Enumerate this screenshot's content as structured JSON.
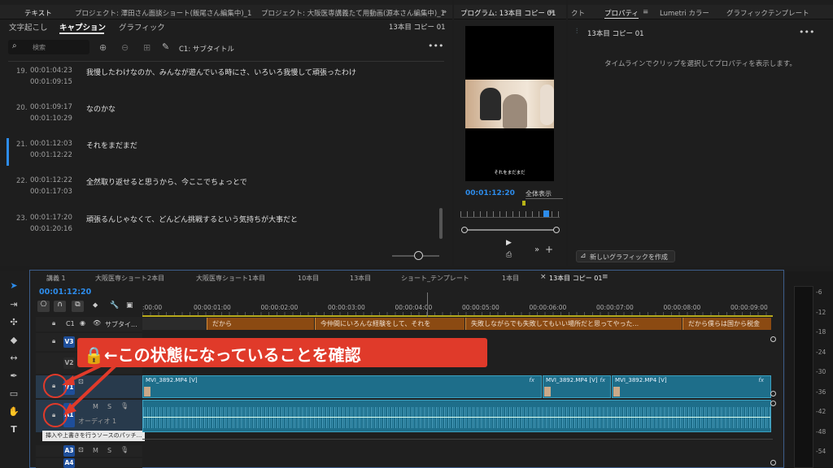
{
  "colors": {
    "accent": "#2d8ceb",
    "caption_clip": "#8b4a12",
    "video_clip": "#1e6e8a",
    "callout": "#e03a2a",
    "track_blue": "#1e4e9a"
  },
  "text_panel": {
    "tabs": [
      "テキスト",
      "プロジェクト: 澤田さん面談ショート(飯尾さん編集中)_1",
      "プロジェクト: 大阪医専講義たて用動画(源本さん編集中)_1"
    ],
    "subtabs": [
      "文字起こし",
      "キャプション",
      "グラフィック"
    ],
    "sequence_name": "13本目 コピー 01",
    "search_placeholder": "検索",
    "track_label": "C1: サブタイトル",
    "captions": [
      {
        "num": "19.",
        "in": "00:01:04:23",
        "out": "00:01:09:15",
        "text": "我慢したわけなのか、みんなが遊んでいる時にさ、いろいろ我慢して頑張ったわけ"
      },
      {
        "num": "20.",
        "in": "00:01:09:17",
        "out": "00:01:10:29",
        "text": "なのかな"
      },
      {
        "num": "21.",
        "in": "00:01:12:03",
        "out": "00:01:12:22",
        "text": "それをまだまだ"
      },
      {
        "num": "22.",
        "in": "00:01:12:22",
        "out": "00:01:17:03",
        "text": "全然取り返せると思うから、今ここでちょっとで"
      },
      {
        "num": "23.",
        "in": "00:01:17:20",
        "out": "00:01:20:16",
        "text": "頑張るんじゃなくて、どんどん挑戦するという気持ちが大事だと"
      }
    ]
  },
  "program_monitor": {
    "tab": "プログラム: 13本目 コピー 01",
    "timecode": "00:01:12:20",
    "zoom": "全体表示",
    "subtitle": "それをまだまだ"
  },
  "properties": {
    "tabs": [
      "クト",
      "プロパティ",
      "Lumetri カラー",
      "グラフィックテンプレート"
    ],
    "title": "13本目 コピー 01",
    "message": "タイムラインでクリップを選択してプロパティを表示します。",
    "new_graphic": "新しいグラフィックを作成"
  },
  "timeline": {
    "tabs": [
      "講義 1",
      "大阪医専ショート2本目",
      "大阪医専ショート1本目",
      "10本目",
      "13本目",
      "ショート_テンプレート",
      "1本目",
      "13本目 コピー 01"
    ],
    "timecode": "00:01:12:20",
    "ruler": [
      ":00:00",
      "00:00:01:00",
      "00:00:02:00",
      "00:00:03:00",
      "00:00:04:00",
      "00:00:05:00",
      "00:00:06:00",
      "00:00:07:00",
      "00:00:08:00",
      "00:00:09:00"
    ],
    "caption_track_label": "C1",
    "caption_track_name": "サブタイ...",
    "caption_clips": [
      "だから",
      "今仲間にいろんな経験をして、それを",
      "失敗しながらでも失敗してもいい場所だと思ってやった...",
      "だから僕らは国から税金"
    ],
    "video_clips": [
      "MVI_3892.MP4 [V]",
      "MVI_3892.MP4 [V]",
      "MVI_3892.MP4 [V]"
    ],
    "tracks": {
      "v3": "V3",
      "v2": "V2",
      "v1": "V1",
      "a1": "A1",
      "a3": "A3",
      "a4": "A4",
      "m": "M",
      "s": "S"
    },
    "audio_name": "オーディオ 1",
    "tooltip": "挿入や上書きを行うソースのパッチ..."
  },
  "callout": {
    "text": "🔒←この状態になっていることを確認"
  },
  "meter_labels": [
    "-6",
    "-12",
    "-18",
    "-24",
    "-30",
    "-36",
    "-42",
    "-48",
    "-54"
  ]
}
